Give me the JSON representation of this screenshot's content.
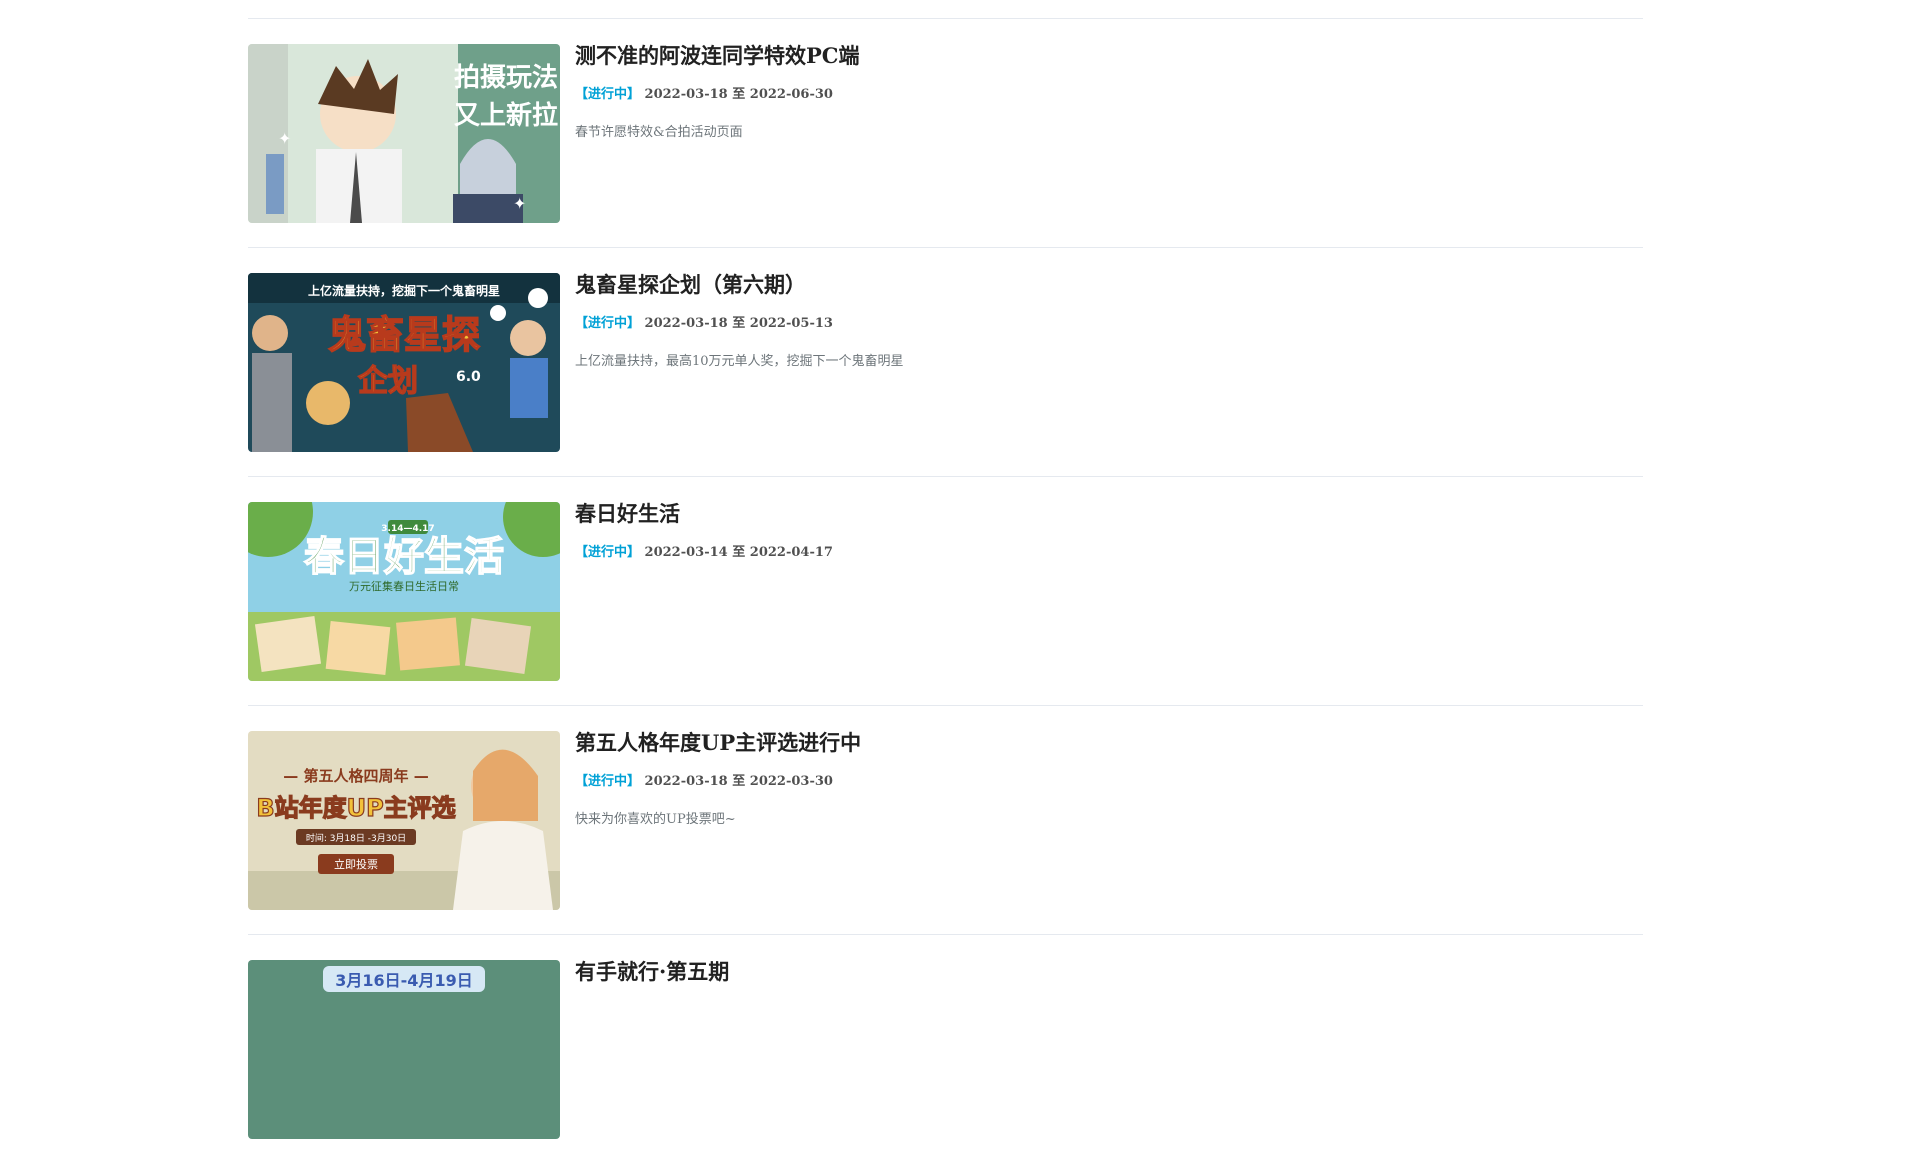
{
  "activities": [
    {
      "title": "测不准的阿波连同学特效PC端",
      "status": "【进行中】",
      "start": "2022-03-18",
      "sep": "至",
      "end": "2022-06-30",
      "desc": "春节许愿特效&合拍活动页面",
      "banner_text": [
        "拍摄玩法",
        "又上新拉"
      ],
      "colors": {
        "bg": "#d9e7da",
        "accent": "#3f6b4a"
      }
    },
    {
      "title": "鬼畜星探企划（第六期）",
      "status": "【进行中】",
      "start": "2022-03-18",
      "sep": "至",
      "end": "2022-05-13",
      "desc": "上亿流量扶持，最高10万元单人奖，挖掘下一个鬼畜明星",
      "banner_text": [
        "上亿流量扶持，挖掘下一个鬼畜明星",
        "鬼畜星探",
        "企划",
        "6.0"
      ],
      "colors": {
        "bg": "#1f4a5a",
        "accent": "#f2c23a"
      }
    },
    {
      "title": "春日好生活",
      "status": "【进行中】",
      "start": "2022-03-14",
      "sep": "至",
      "end": "2022-04-17",
      "desc": "",
      "banner_text": [
        "3.14—4.17",
        "春日好生活",
        "万元征集春日生活日常"
      ],
      "colors": {
        "bg": "#8fd0e6",
        "accent": "#3f8a3c"
      }
    },
    {
      "title": "第五人格年度UP主评选进行中",
      "status": "【进行中】",
      "start": "2022-03-18",
      "sep": "至",
      "end": "2022-03-30",
      "desc": "快来为你喜欢的UP投票吧~",
      "banner_text": [
        "— 第五人格四周年 —",
        "B站年度UP主评选",
        "时间: 3月18日 -3月30日",
        "立即投票"
      ],
      "colors": {
        "bg": "#e3dcc2",
        "accent": "#8a3b1e"
      }
    },
    {
      "title": "有手就行·第五期",
      "status": "",
      "start": "",
      "sep": "",
      "end": "",
      "desc": "",
      "banner_text": [
        "3月16日-4月19日"
      ],
      "colors": {
        "bg": "#5c8f7a",
        "accent": "#3a5bb0"
      }
    }
  ]
}
